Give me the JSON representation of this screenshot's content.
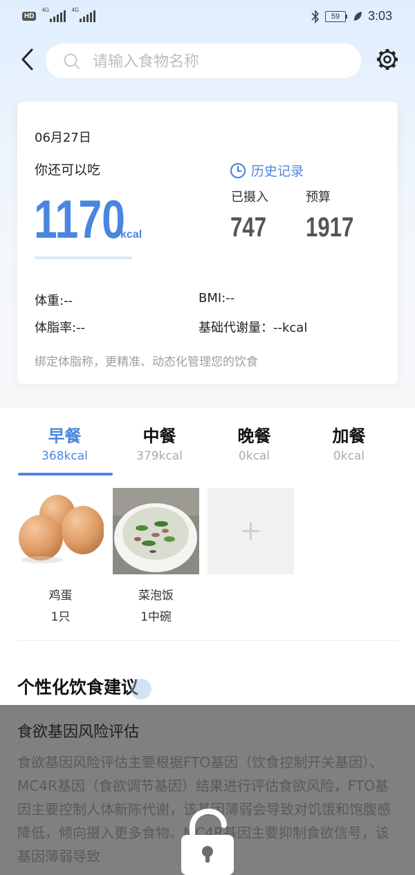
{
  "status_bar": {
    "hd": "HD",
    "net1": "4G",
    "net2": "4G",
    "battery": "59",
    "time": "3:03"
  },
  "header": {
    "search_placeholder": "请输入食物名称"
  },
  "summary": {
    "date": "06月27日",
    "can_eat_label": "你还可以吃",
    "remaining": "1170",
    "remaining_unit": "kcal",
    "history_label": "历史记录",
    "intake_label": "已摄入",
    "intake_value": "747",
    "budget_label": "预算",
    "budget_value": "1917",
    "weight": "体重:--",
    "bmi": "BMI:--",
    "body_fat": "体脂率:--",
    "bmr": "基础代谢量：--kcal",
    "bind_hint": "绑定体脂称，更精准、动态化管理您的饮食"
  },
  "meals": {
    "tabs": [
      {
        "name": "早餐",
        "kcal": "368kcal"
      },
      {
        "name": "中餐",
        "kcal": "379kcal"
      },
      {
        "name": "晚餐",
        "kcal": "0kcal"
      },
      {
        "name": "加餐",
        "kcal": "0kcal"
      }
    ],
    "active_tab": "早餐",
    "foods": [
      {
        "name": "鸡蛋",
        "amount": "1只"
      },
      {
        "name": "菜泡饭",
        "amount": "1中碗"
      }
    ]
  },
  "advice": {
    "title": "个性化饮食建议",
    "card_title": "食欲基因风险评估",
    "card_text": "食欲基因风险评估主要根据FTO基因（饮食控制开关基因）、MC4R基因（食欲调节基因）结果进行评估食欲风险，FTO基因主要控制人体新陈代谢，该基因薄弱会导致对饥饿和饱腹感降低，倾向摄入更多食物。MC4R基因主要抑制食欲信号，该基因薄弱导致"
  },
  "colors": {
    "accent": "#4a86e0",
    "overlay": "#808080"
  }
}
